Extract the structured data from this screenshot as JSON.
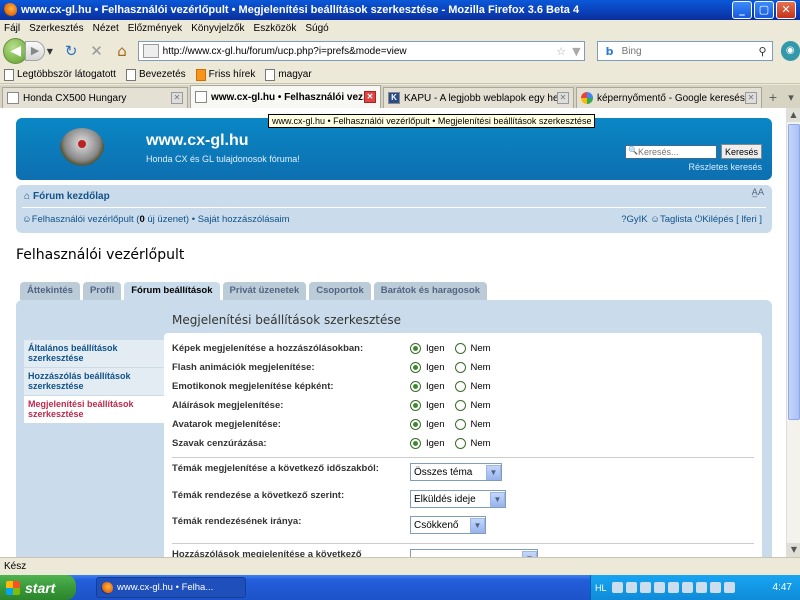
{
  "window": {
    "title": "www.cx-gl.hu • Felhasználói vezérlőpult • Megjelenítési beállítások szerkesztése - Mozilla Firefox 3.6 Beta 4"
  },
  "menu": [
    "Fájl",
    "Szerkesztés",
    "Nézet",
    "Előzmények",
    "Könyvjelzők",
    "Eszközök",
    "Súgó"
  ],
  "nav": {
    "url": "http://www.cx-gl.hu/forum/ucp.php?i=prefs&mode=view",
    "search_placeholder": "Bing",
    "search_engine": "b"
  },
  "bookmarks": [
    "Legtöbbször látogatott",
    "Bevezetés",
    "Friss hírek",
    "magyar"
  ],
  "tabs": [
    {
      "label": "Honda CX500 Hungary",
      "active": false
    },
    {
      "label": "www.cx-gl.hu • Felhasználói vez...",
      "active": true
    },
    {
      "label": "KAPU - A legjobb weblapok egy helyen",
      "active": false
    },
    {
      "label": "képernyőmentő - Google keresés",
      "active": false
    }
  ],
  "tooltip": "www.cx-gl.hu • Felhasználói vezérlőpult • Megjelenítési beállítások szerkesztése",
  "forum": {
    "site_title": "www.cx-gl.hu",
    "site_desc": "Honda CX és GL tulajdonosok fóruma!",
    "search_placeholder": "Keresés...",
    "search_button": "Keresés",
    "adv_search": "Részletes keresés",
    "home": "Fórum kezdőlap",
    "font_size": "A̲A",
    "ucp_link_pre": "Felhasználói vezérlőpult (",
    "ucp_count": "0",
    "ucp_link_post": " új üzenet) • Saját hozzászólásaim",
    "faq": "GyIK",
    "members": "Taglista",
    "logout": "Kilépés [ lferi ]"
  },
  "panel_title": "Felhasználói vezérlőpult",
  "ucp_tabs": [
    "Áttekintés",
    "Profil",
    "Fórum beállítások",
    "Privát üzenetek",
    "Csoportok",
    "Barátok és haragosok"
  ],
  "sidebar": [
    {
      "label": "Általános beállítások szerkesztése",
      "active": false
    },
    {
      "label": "Hozzászólás beállítások szerkesztése",
      "active": false
    },
    {
      "label": "Megjelenítési beállítások szerkesztése",
      "active": true
    }
  ],
  "section_title": "Megjelenítési beállítások szerkesztése",
  "radio_options": {
    "yes": "Igen",
    "no": "Nem"
  },
  "settings": [
    {
      "label": "Képek megjelenítése a hozzászólásokban:",
      "value": "Igen"
    },
    {
      "label": "Flash animációk megjelenítése:",
      "value": "Igen"
    },
    {
      "label": "Emotikonok megjelenítése képként:",
      "value": "Igen"
    },
    {
      "label": "Aláírások megjelenítése:",
      "value": "Igen"
    },
    {
      "label": "Avatarok megjelenítése:",
      "value": "Igen"
    },
    {
      "label": "Szavak cenzúrázása:",
      "value": "Igen"
    }
  ],
  "selects": [
    {
      "label": "Témák megjelenítése a következő időszakból:",
      "value": "Összes téma"
    },
    {
      "label": "Témák rendezése a következő szerint:",
      "value": "Elküldés ideje"
    },
    {
      "label": "Témák rendezésének iránya:",
      "value": "Csökkenő"
    },
    {
      "label": "Hozzászólások megjelenítése a következő",
      "value": ""
    }
  ],
  "status": "Kész",
  "taskbar": {
    "start": "start",
    "task": "www.cx-gl.hu • Felha...",
    "lang": "HL",
    "clock": "4:47"
  }
}
